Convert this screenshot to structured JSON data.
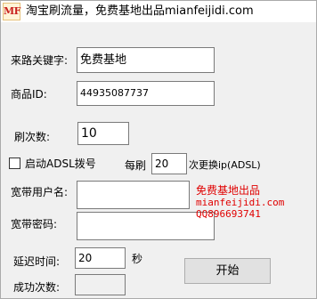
{
  "window": {
    "icon_text": "MF",
    "title": "淘宝刷流量，免费基地出品mianfeijidi.com"
  },
  "form": {
    "source_keyword": {
      "label": "来路关键字:",
      "value": "免费基地"
    },
    "product_id": {
      "label": "商品ID:",
      "value": "44935087737"
    },
    "refresh_count": {
      "label": "刷次数:",
      "value": "10"
    },
    "adsl": {
      "checkbox_label": "启动ADSL拨号",
      "checked": false,
      "every_label": "每刷",
      "interval_value": "20",
      "suffix_label": "次更换ip(ADSL)"
    },
    "broadband_user": {
      "label": "宽带用户名:",
      "value": ""
    },
    "broadband_password": {
      "label": "宽带密码:",
      "value": ""
    },
    "delay": {
      "label": "延迟时间:",
      "value": "20",
      "unit": "秒"
    },
    "success_count": {
      "label": "成功次数:",
      "value": ""
    }
  },
  "promo": {
    "line1": "免费基地出品",
    "line2": "mianfeijidi.com",
    "line3": "QQ896693741"
  },
  "buttons": {
    "start_label": "开始"
  },
  "colors": {
    "promo_text": "#e00000",
    "window_bg": "#f0f0f0"
  }
}
